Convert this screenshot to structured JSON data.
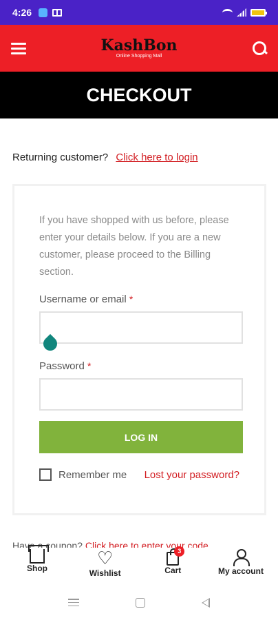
{
  "status": {
    "time": "4:26"
  },
  "header": {
    "logo": "KashBon",
    "tagline": "Online Shopping Mall"
  },
  "banner": {
    "title": "CHECKOUT"
  },
  "returning": {
    "text": "Returning customer?",
    "link": "Click here to login"
  },
  "login": {
    "intro": "If you have shopped with us before, please enter your details below. If you are a new customer, please proceed to the Billing section.",
    "username_label": "Username or email",
    "password_label": "Password",
    "required": "*",
    "button": "LOG IN",
    "remember": "Remember me",
    "lost": "Lost your password?"
  },
  "partial": {
    "text": "Have a coupon?",
    "link": "Click here to enter your code"
  },
  "bottom_nav": {
    "items": [
      {
        "label": "Shop",
        "icon": "shop-icon"
      },
      {
        "label": "Wishlist",
        "icon": "heart-icon"
      },
      {
        "label": "Cart",
        "icon": "cart-icon",
        "badge": "3"
      },
      {
        "label": "My account",
        "icon": "user-icon"
      }
    ]
  },
  "colors": {
    "status_bar": "#4a22c7",
    "header": "#ed1f26",
    "banner": "#000000",
    "accent_link": "#d21d22",
    "button": "#81b33c",
    "cursor": "#11867d"
  }
}
